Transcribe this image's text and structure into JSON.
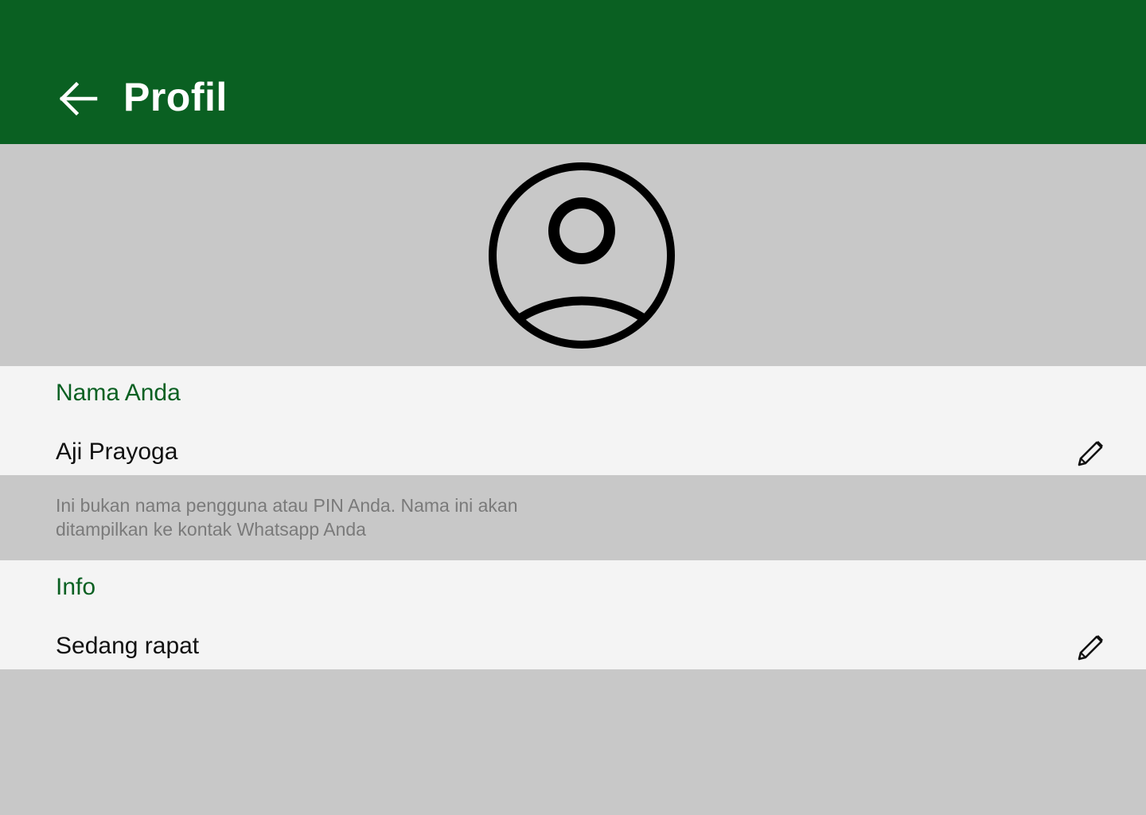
{
  "header": {
    "title": "Profil",
    "back_icon": "arrow-left-icon",
    "background_color": "#0a6022"
  },
  "avatar": {
    "icon": "user-circle-icon"
  },
  "name_section": {
    "label": "Nama Anda",
    "value": "Aji Prayoga",
    "edit_icon": "pencil-icon"
  },
  "hint": {
    "line1": "Ini bukan nama pengguna atau PIN Anda. Nama ini akan",
    "line2": "ditampilkan ke kontak Whatsapp Anda"
  },
  "info_section": {
    "label": "Info",
    "value": "Sedang rapat",
    "edit_icon": "pencil-icon"
  },
  "colors": {
    "accent": "#0a6022",
    "section_bg": "#f4f4f4",
    "page_bg": "#c8c8c8",
    "hint_text": "#7a7a7a"
  }
}
